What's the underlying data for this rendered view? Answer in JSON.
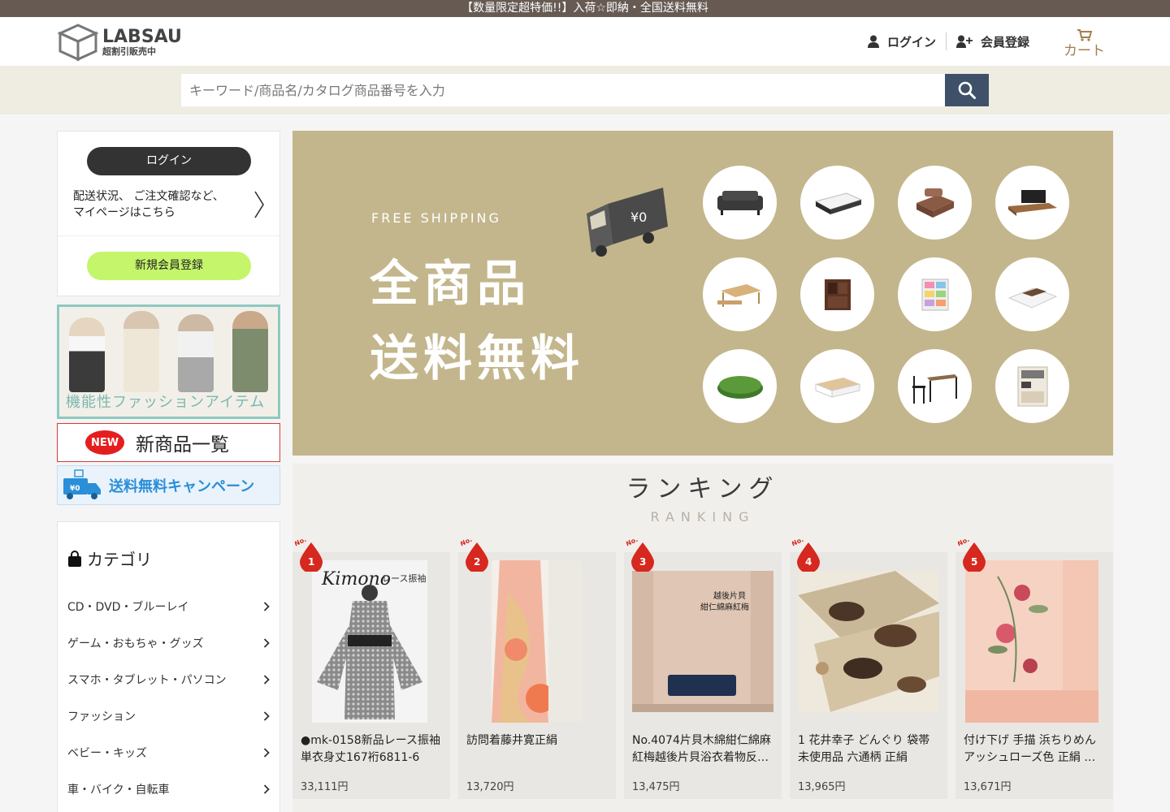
{
  "topbar": {
    "text": "【数量限定超特価!!】入荷☆即納・全国送料無料"
  },
  "header": {
    "logo_main": "LABSAU",
    "logo_sub": "超割引販売中",
    "login_label": "ログイン",
    "register_label": "会員登録",
    "cart_label": "カート"
  },
  "search": {
    "placeholder": "キーワード/商品名/カタログ商品番号を入力"
  },
  "sidebar": {
    "login_button": "ログイン",
    "login_desc_line1": "配送状況、 ご注文確認など、",
    "login_desc_line2": "マイページはこちら",
    "register_button": "新規会員登録",
    "fashion_banner": "機能性ファッションアイテム",
    "new_badge": "NEW",
    "new_banner": "新商品一覧",
    "ship_banner": "送料無料キャンペーン",
    "category_title": "カテゴリ",
    "categories": [
      "CD・DVD・ブルーレイ",
      "ゲーム・おもちゃ・グッズ",
      "スマホ・タブレット・パソコン",
      "ファッション",
      "ベビー・キッズ",
      "車・バイク・自転車"
    ]
  },
  "hero": {
    "free_shipping": "FREE SHIPPING",
    "line1": "全商品",
    "line2": "送料無料",
    "truck_label": "¥0"
  },
  "ranking": {
    "title": "ランキング",
    "subtitle": "RANKING",
    "badge_prefix": "No.",
    "items": [
      {
        "rank": "1",
        "name": "●mk-0158新品レース振袖単衣身丈167裄6811-6",
        "price": "33,111円",
        "img_title": "Kimono",
        "img_sub": "レース振袖"
      },
      {
        "rank": "2",
        "name": "訪問着藤井寛正絹",
        "price": "13,720円"
      },
      {
        "rank": "3",
        "name": "No.4074片貝木綿紺仁綿麻紅梅越後片貝浴衣着物反…",
        "price": "13,475円",
        "img_title": "越後片貝",
        "img_sub": "紺仁綿麻紅梅"
      },
      {
        "rank": "4",
        "name": "1 花井幸子 どんぐり 袋帯 未使用品 六通柄 正絹",
        "price": "13,965円"
      },
      {
        "rank": "5",
        "name": "付け下げ 手描 浜ちりめん アッシュローズ色 正絹 …",
        "price": "13,671円"
      }
    ]
  },
  "colors": {
    "topbar": "#665a53",
    "search_band": "#efece2",
    "search_button": "#3f5168",
    "hero_bg": "#c3b68c",
    "register_pill": "#c4f56a",
    "rank_badge": "#d6281e"
  }
}
